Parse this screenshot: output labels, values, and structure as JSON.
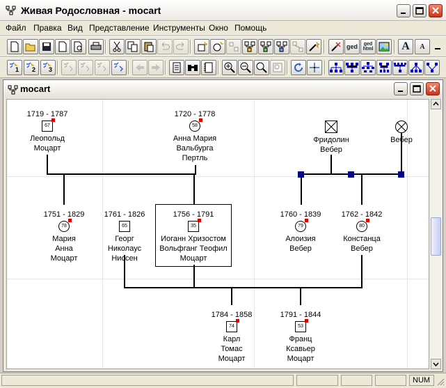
{
  "window": {
    "title": "Живая Родословная - mocart",
    "icon": "family-tree-icon",
    "controls": [
      "minimize-icon",
      "maximize-icon",
      "close-icon"
    ]
  },
  "menu": [
    "Файл",
    "Правка",
    "Вид",
    "Представление",
    "Инструменты",
    "Окно",
    "Помощь"
  ],
  "toolbar1": {
    "buttons": [
      "new-file-icon",
      "open-folder-icon",
      "save-icon",
      "page-icon",
      "print-preview-icon",
      "print-icon",
      "cut-icon",
      "copy-icon",
      "paste-icon",
      "undo-icon",
      "redo-icon",
      "new-person-icon",
      "add-parent-icon",
      "add-child-icon",
      "add-relative-icon",
      "link-icon",
      "unlink-icon",
      "wand-icon",
      "gedcom-import-icon",
      "gedcom-export-icon",
      "gedcom-html-icon",
      "picture-icon",
      "font-larger-icon",
      "font-smaller-icon"
    ],
    "labels": {
      "ged": "ged",
      "ged_html": "ged\nhtml",
      "font_big": "A",
      "font_small": "A"
    }
  },
  "toolbar2": {
    "buttons": [
      "person-1-icon",
      "person-2-icon",
      "person-3-icon",
      "person-star-icon",
      "person-star-2-icon",
      "person-star-3-icon",
      "person-refresh-icon",
      "back-arrow-icon",
      "forward-arrow-icon",
      "document-icon",
      "binoculars-icon",
      "notebook-icon",
      "zoom-in-icon",
      "zoom-out-icon",
      "zoom-fit-icon",
      "zoom-page-icon",
      "refresh-icon",
      "center-icon",
      "tree-layout-1-icon",
      "tree-layout-2-icon",
      "tree-layout-3-icon",
      "tree-layout-4-icon",
      "tree-layout-5-icon",
      "tree-layout-6-icon",
      "tree-layout-7-icon"
    ]
  },
  "child_window": {
    "title": "mocart"
  },
  "tree": {
    "persons": [
      {
        "dates": "1719 - 1787",
        "age": "67",
        "name": "Леопольд\nМоцарт",
        "sex": "male"
      },
      {
        "dates": "1720 - 1778",
        "age": "58",
        "name": "Анна Мария\nВальбурга\nПертль",
        "sex": "female"
      },
      {
        "dates": "",
        "age": "",
        "name": "Фридолин\nВебер",
        "sex": "male"
      },
      {
        "dates": "",
        "age": "",
        "name": "Вебер",
        "sex": "female"
      },
      {
        "dates": "1751 - 1829",
        "age": "78",
        "name": "Мария\nАнна\nМоцарт",
        "sex": "female"
      },
      {
        "dates": "1761 - 1826",
        "age": "65",
        "name": "Георг\nНиколаус\nНиссен",
        "sex": "male"
      },
      {
        "dates": "1756 - 1791",
        "age": "35",
        "name": "Иоганн Хризостом\nВольфганг Теофил\nМоцарт",
        "sex": "male"
      },
      {
        "dates": "1760 - 1839",
        "age": "79",
        "name": "Алоизия\nВебер",
        "sex": "female"
      },
      {
        "dates": "1762 - 1842",
        "age": "80",
        "name": "Констанца\nВебер",
        "sex": "female"
      },
      {
        "dates": "1784 - 1858",
        "age": "74",
        "name": "Карл\nТомас\nМоцарт",
        "sex": "male"
      },
      {
        "dates": "1791 - 1844",
        "age": "53",
        "name": "Франц\nКсавьер\nМоцарт",
        "sex": "male"
      }
    ]
  },
  "status": {
    "num": "NUM"
  },
  "colors": {
    "marker": "#e00000",
    "junction": "#000080",
    "close_button": "#c8331a"
  }
}
